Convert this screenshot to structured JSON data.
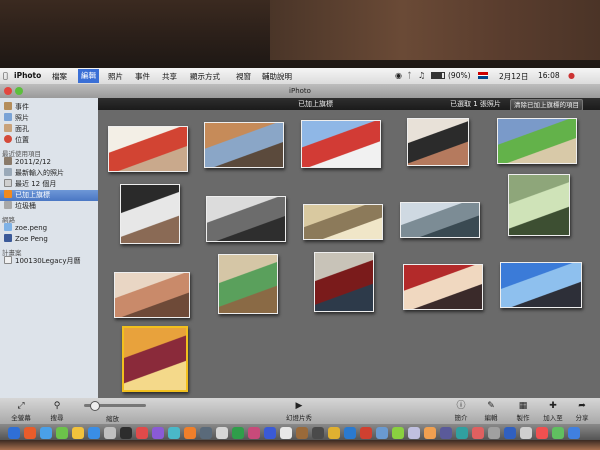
{
  "menubar": {
    "app_name": "iPhoto",
    "items": [
      "檔案",
      "編輯",
      "照片",
      "事件",
      "共享",
      "顯示方式",
      "視窗",
      "輔助說明"
    ],
    "active_index": 1,
    "battery": "(90%)",
    "date": "2月12日",
    "time": "16:08"
  },
  "window": {
    "title": "iPhoto"
  },
  "sidebar": {
    "library": [
      "事件",
      "照片",
      "面孔",
      "位置"
    ],
    "recent_header": "最近使用項目",
    "recent": [
      "2011/2/12",
      "最新輸入的照片",
      "最近 12 個月",
      "已加上旗標",
      "垃圾桶"
    ],
    "selected": "已加上旗標",
    "web_header": "網路",
    "web": [
      "zoe.peng",
      "Zoe Peng"
    ],
    "projects_header": "計畫案",
    "projects": [
      "100130Legacy月曆"
    ]
  },
  "banner": {
    "title": "已加上旗標",
    "selection_count": "已選取 1 張照片",
    "clear_button": "清除已加上旗標的項目"
  },
  "photos": [
    {
      "name": "no-signs",
      "colors": [
        "#f3efe6",
        "#d24433",
        "#c9a98c"
      ]
    },
    {
      "name": "rooftops",
      "colors": [
        "#c68b59",
        "#8aa6c7",
        "#5b4a3c"
      ]
    },
    {
      "name": "red-building",
      "colors": [
        "#8fb7e6",
        "#d23b35",
        "#f1f1f1"
      ]
    },
    {
      "name": "group-selfie",
      "colors": [
        "#e8e1d8",
        "#2b2b2b",
        "#b57a5e"
      ]
    },
    {
      "name": "green-car",
      "colors": [
        "#7a9ac9",
        "#63b24a",
        "#d8c9a8"
      ]
    },
    {
      "name": "chef",
      "colors": [
        "#2a2a2a",
        "#e7e7e7",
        "#8a6a55"
      ]
    },
    {
      "name": "street-bw",
      "colors": [
        "#dcdcdc",
        "#6c6c6c",
        "#2e2e2e"
      ]
    },
    {
      "name": "blurred-street",
      "colors": [
        "#d9c9a0",
        "#8c7a5a",
        "#f0e6c8"
      ]
    },
    {
      "name": "city-street",
      "colors": [
        "#cfd9e2",
        "#7c8c95",
        "#3a4a52"
      ]
    },
    {
      "name": "glass-drink",
      "colors": [
        "#8ea67a",
        "#cfe3b8",
        "#3d4f32"
      ]
    },
    {
      "name": "pastry-plate",
      "colors": [
        "#e9d6c4",
        "#c98a6a",
        "#6e4a38"
      ]
    },
    {
      "name": "cartoon-frog",
      "colors": [
        "#d5c6a6",
        "#5aa05c",
        "#8a6a45"
      ]
    },
    {
      "name": "restaurant-room",
      "colors": [
        "#c8c3b8",
        "#7a1b1b",
        "#2d3a4a"
      ]
    },
    {
      "name": "two-friends",
      "colors": [
        "#b32a2a",
        "#f0d8c0",
        "#3a2a2a"
      ]
    },
    {
      "name": "seaside",
      "colors": [
        "#3b7bd8",
        "#8ec0ee",
        "#2d2f38"
      ]
    },
    {
      "name": "calendar-print",
      "colors": [
        "#e8a23c",
        "#8a2a3a",
        "#f4d98a"
      ]
    }
  ],
  "toolbar": {
    "fullscreen": "全螢幕",
    "search": "搜尋",
    "zoom": "縮放",
    "slideshow": "幻燈片秀",
    "info": "簡介",
    "edit": "編輯",
    "create": "製作",
    "add_to": "加入至",
    "share": "分享"
  },
  "dock": {
    "icon_colors": [
      "#2f6fd6",
      "#e85c2a",
      "#4aa0e8",
      "#6cc24a",
      "#f2c23c",
      "#3a8ee6",
      "#c0c0c0",
      "#2d2d2d",
      "#e04a4a",
      "#8a5ad6",
      "#4ab8c8",
      "#f07f2a",
      "#5a6a7a",
      "#d6d6d6",
      "#2f9e4a",
      "#c84a7a",
      "#3a5ad6",
      "#e8e8e8",
      "#9a6a3a",
      "#4a4a4a",
      "#e0b030",
      "#2a7ad0",
      "#d04030",
      "#6a9ad0",
      "#8ad040",
      "#c0c0e0",
      "#f0a050",
      "#5a5a9a",
      "#30a0a0",
      "#e06060",
      "#a0a0a0",
      "#3060c0",
      "#d0d0d0",
      "#f05050",
      "#60c060",
      "#4080e0"
    ]
  }
}
